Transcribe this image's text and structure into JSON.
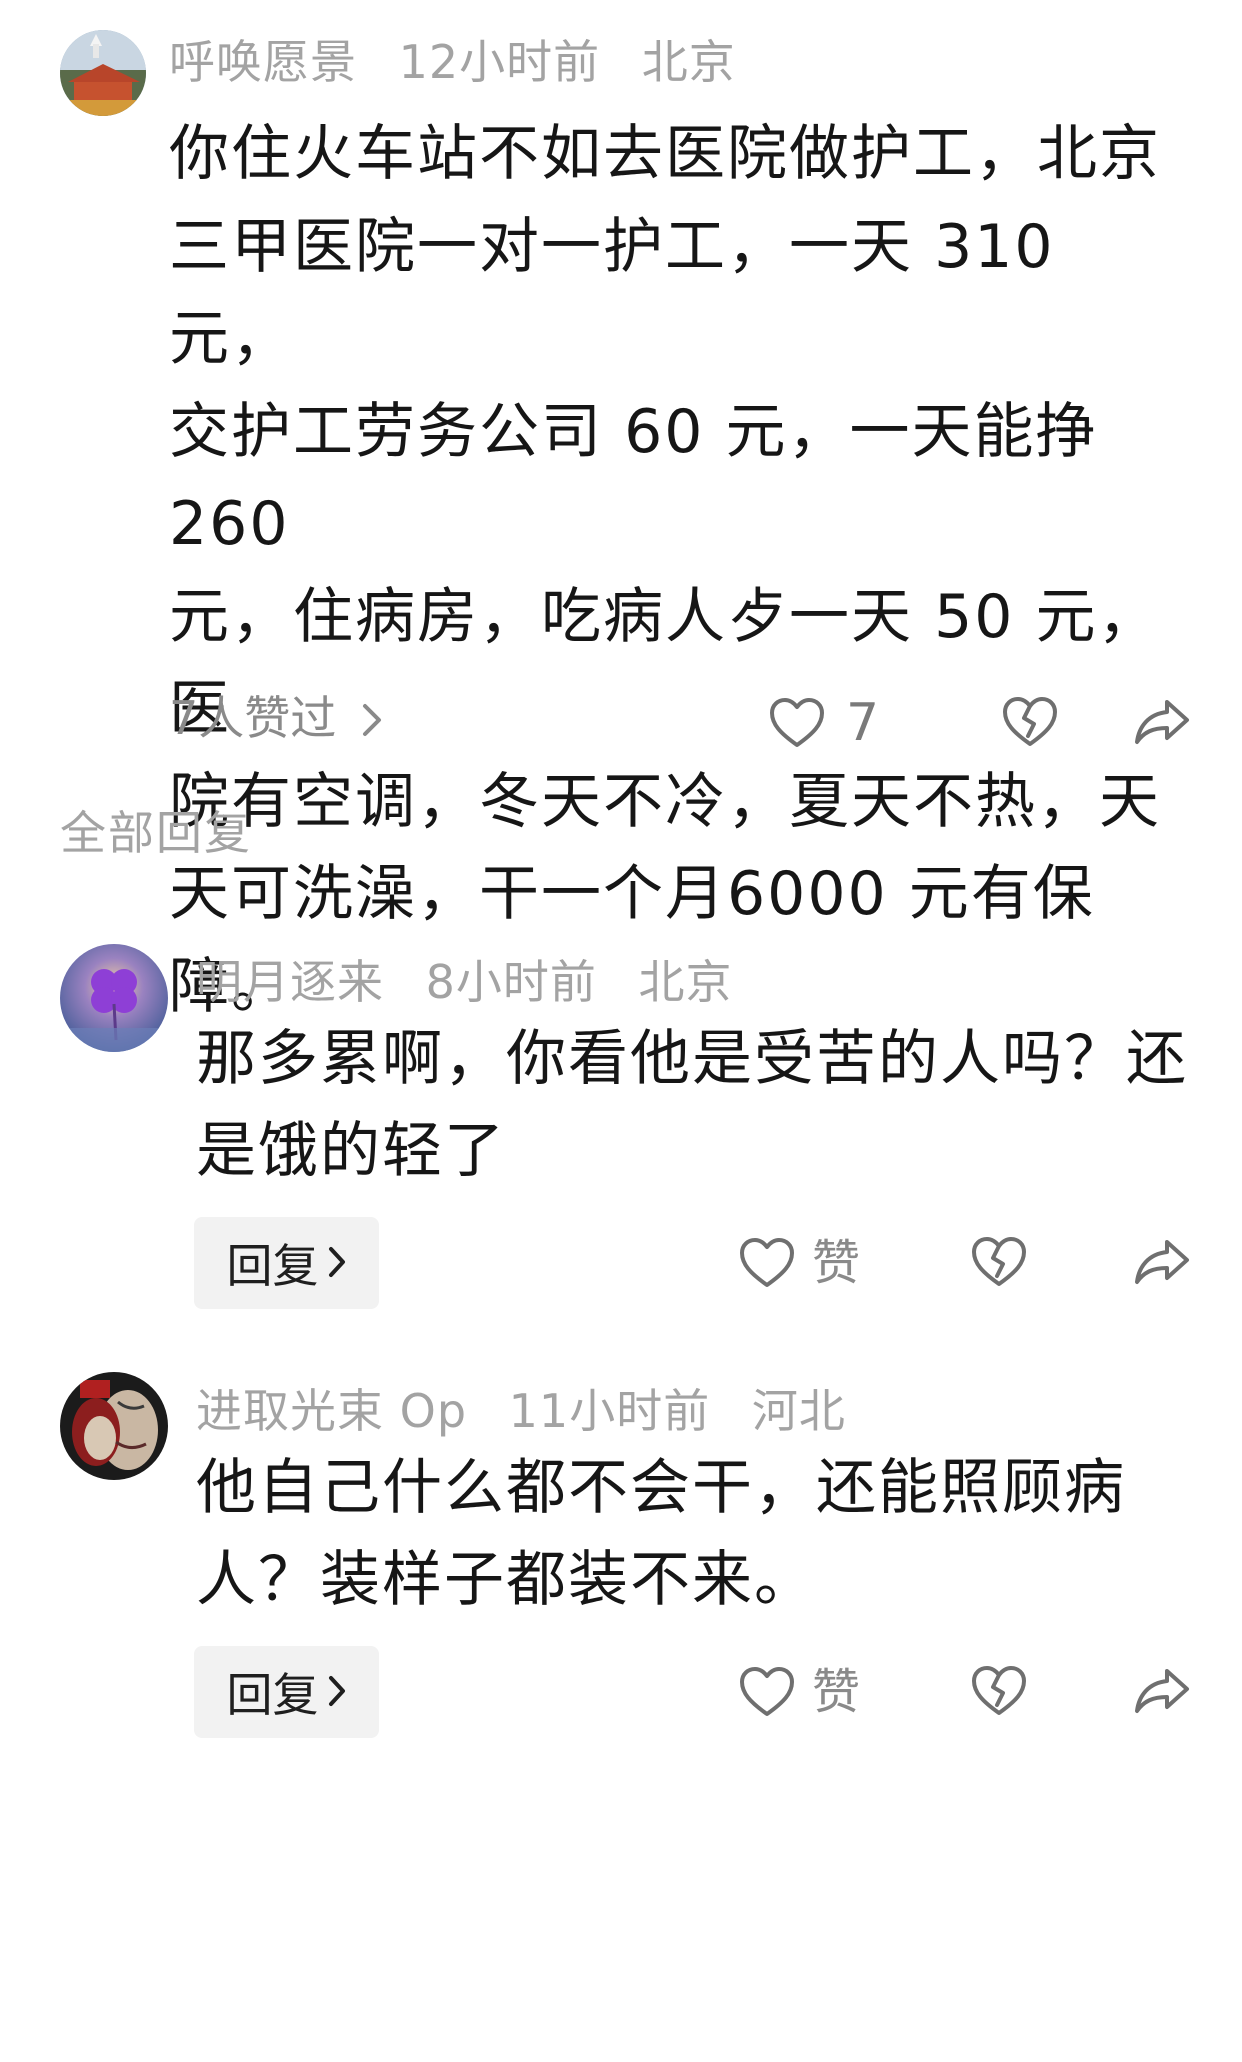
{
  "main_comment": {
    "username": "呼唤愿景",
    "time": "12小时前",
    "location": "北京",
    "lines": [
      "你住火车站不如去医院做护工，北京",
      "三甲医院一对一护工，一天 310 元，",
      "交护工劳务公司 60 元，一天能挣 260",
      "元，住病房，吃病人歺一天 50 元，医",
      "院有空调，冬天不冷，夏天不热，天",
      "天可洗澡，干一个月6000 元有保障。"
    ],
    "likers_text": "7人赞过",
    "like_count": "7"
  },
  "section_title": "全部回复",
  "replies": [
    {
      "username": "明月逐来",
      "time": "8小时前",
      "location": "北京",
      "lines": [
        "那多累啊，你看他是受苦的人吗？还",
        "是饿的轻了"
      ],
      "reply_label": "回复",
      "like_label": "赞"
    },
    {
      "username": "进取光束 Op",
      "time": "11小时前",
      "location": "河北",
      "lines": [
        "他自己什么都不会干，还能照顾病",
        "人？装样子都装不来。"
      ],
      "reply_label": "回复",
      "like_label": "赞"
    }
  ],
  "icons": {
    "like": "heart-outline-icon",
    "dislike": "broken-heart-icon",
    "share": "share-arrow-icon",
    "chevron": "chevron-right-icon"
  },
  "colors": {
    "meta_text": "#a3a3a3",
    "body_text": "#161616",
    "icon_stroke": "#6f6f6f",
    "reply_button_bg": "#f2f2f2"
  }
}
